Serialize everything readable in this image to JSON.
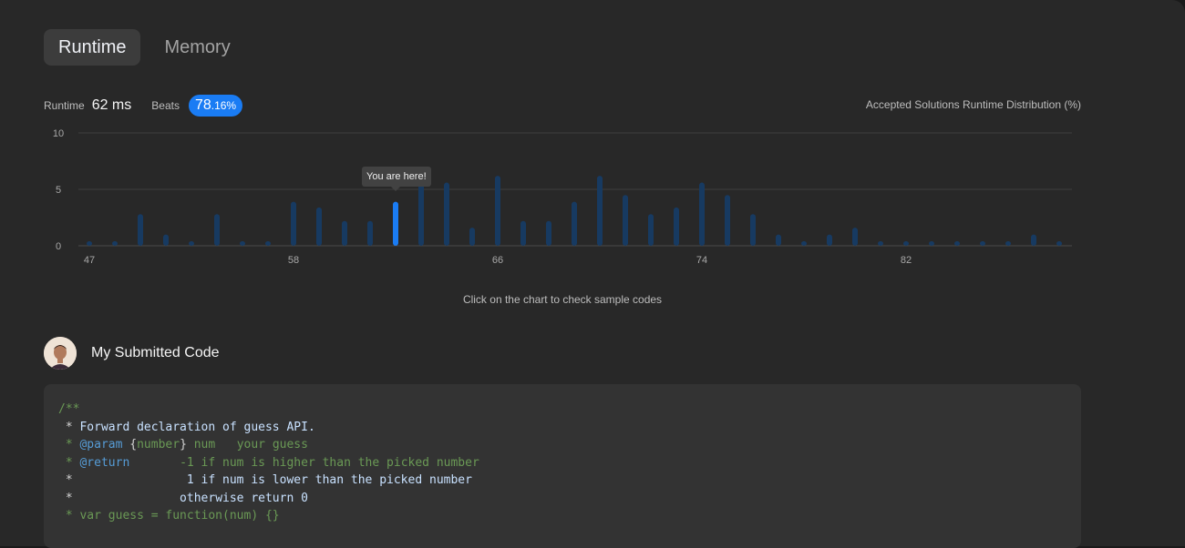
{
  "tabs": [
    {
      "label": "Runtime",
      "active": true
    },
    {
      "label": "Memory",
      "active": false
    }
  ],
  "stats": {
    "runtime_label": "Runtime",
    "runtime_value": "62 ms",
    "beats_label": "Beats",
    "beats_int": "78",
    "beats_dec": ".16%"
  },
  "distribution_title": "Accepted Solutions Runtime Distribution (%)",
  "chart_data": {
    "type": "bar",
    "title": "Accepted Solutions Runtime Distribution (%)",
    "ylim": [
      0,
      10
    ],
    "y_ticks": [
      "10",
      "5",
      "0"
    ],
    "x_tick_labels": [
      "47",
      "58",
      "66",
      "74",
      "82"
    ],
    "values": [
      0.4,
      0.4,
      2.8,
      1.0,
      0.4,
      2.8,
      0.4,
      0.4,
      3.9,
      3.4,
      2.2,
      2.2,
      3.9,
      5.6,
      5.6,
      1.6,
      6.2,
      2.2,
      2.2,
      3.9,
      6.2,
      4.5,
      2.8,
      3.4,
      5.6,
      4.5,
      2.8,
      1.0,
      0.4,
      1.0,
      1.6,
      0.4,
      0.4,
      0.4,
      0.4,
      0.4,
      0.4,
      1.0,
      0.4
    ],
    "highlight_index": 12,
    "colors": {
      "bar": "#173a61",
      "highlight": "#1a7cf4",
      "grid": "#3e3e3e",
      "axis": "#4a4a4a"
    }
  },
  "tooltip": "You are here!",
  "chart_hint": "Click on the chart to check sample codes",
  "submission": {
    "title": "My Submitted Code"
  },
  "code": {
    "l1": "/**",
    "l2_star": " * ",
    "l2_text": "Forward declaration of guess API.",
    "l3_star": " * ",
    "l3_tag": "@param",
    "l3_b1": " {",
    "l3_type": "number",
    "l3_b2": "}",
    "l3_rest": " num   your guess",
    "l4_star": " * ",
    "l4_tag": "@return",
    "l4_rest": "       -1 if num is higher than the picked number",
    "l5_star": " *",
    "l5_text": "                1 if num is lower than the picked number",
    "l6_star": " *",
    "l6_text": "               otherwise return 0",
    "l7": " * var guess = function(num) {}"
  }
}
